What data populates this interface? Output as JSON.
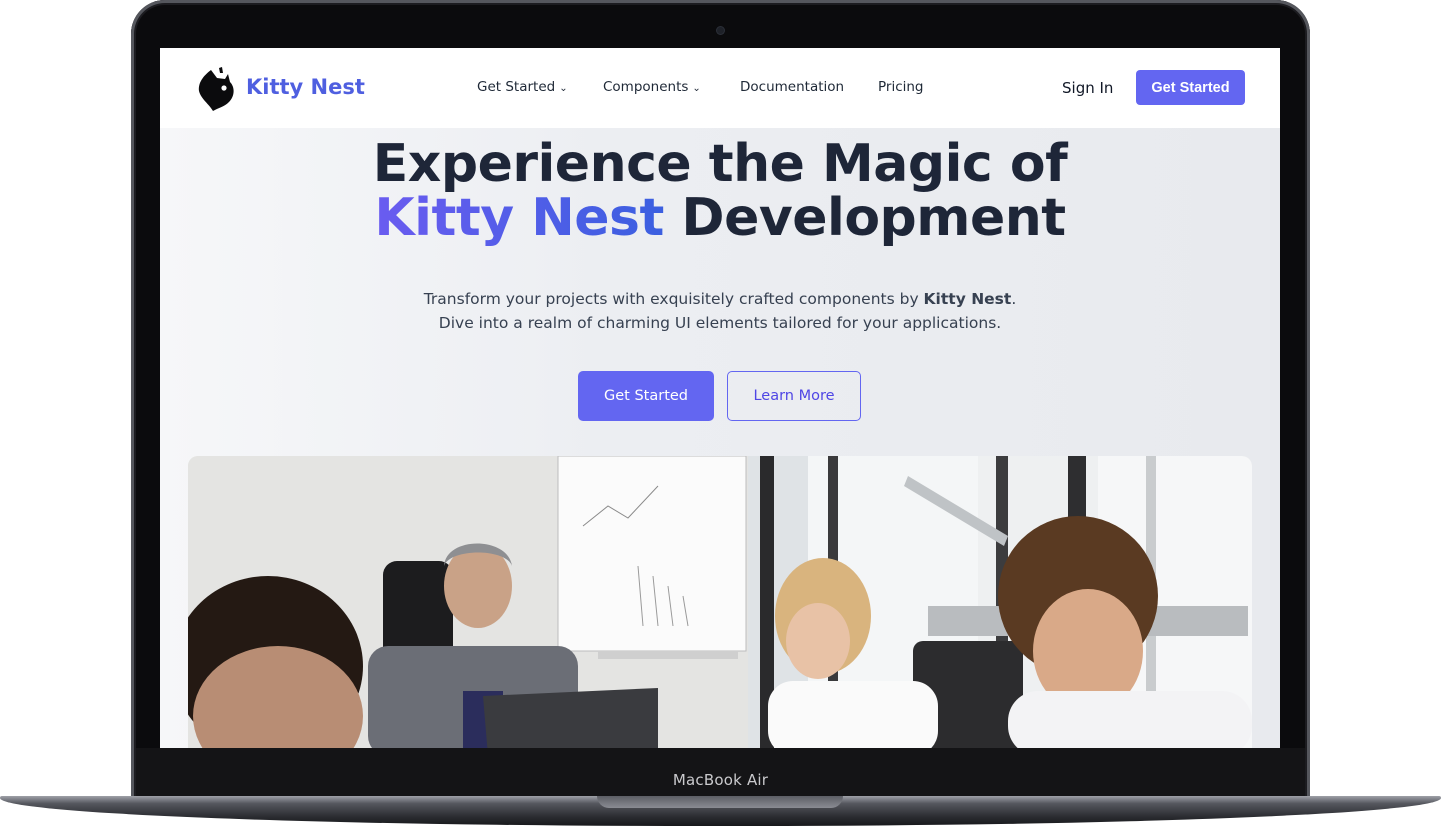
{
  "device": {
    "label": "MacBook Air"
  },
  "site": {
    "brand": "Kitty Nest",
    "nav": {
      "items": [
        {
          "label": "Get Started",
          "has_dropdown": true
        },
        {
          "label": "Components",
          "has_dropdown": true
        },
        {
          "label": "Documentation",
          "has_dropdown": false
        },
        {
          "label": "Pricing",
          "has_dropdown": false
        }
      ],
      "sign_in": "Sign In",
      "cta": "Get Started"
    },
    "hero": {
      "title_line1": "Experience the Magic of",
      "title_accent": "Kitty Nest",
      "title_line2_rest": " Development",
      "subtitle_part1": "Transform your projects with exquisitely crafted components by ",
      "subtitle_bold": "Kitty Nest",
      "subtitle_part2": ".",
      "subtitle_line2": "Dive into a realm of charming UI elements tailored for your applications.",
      "primary_button": "Get Started",
      "secondary_button": "Learn More"
    },
    "image": {
      "alt": "team meeting photo"
    }
  },
  "colors": {
    "accent": "#6366f1",
    "brand_text": "#4f5fe0",
    "heading": "#1e2638"
  },
  "icons": {
    "logo": "cat-head-icon",
    "dropdown": "chevron-down-icon"
  }
}
